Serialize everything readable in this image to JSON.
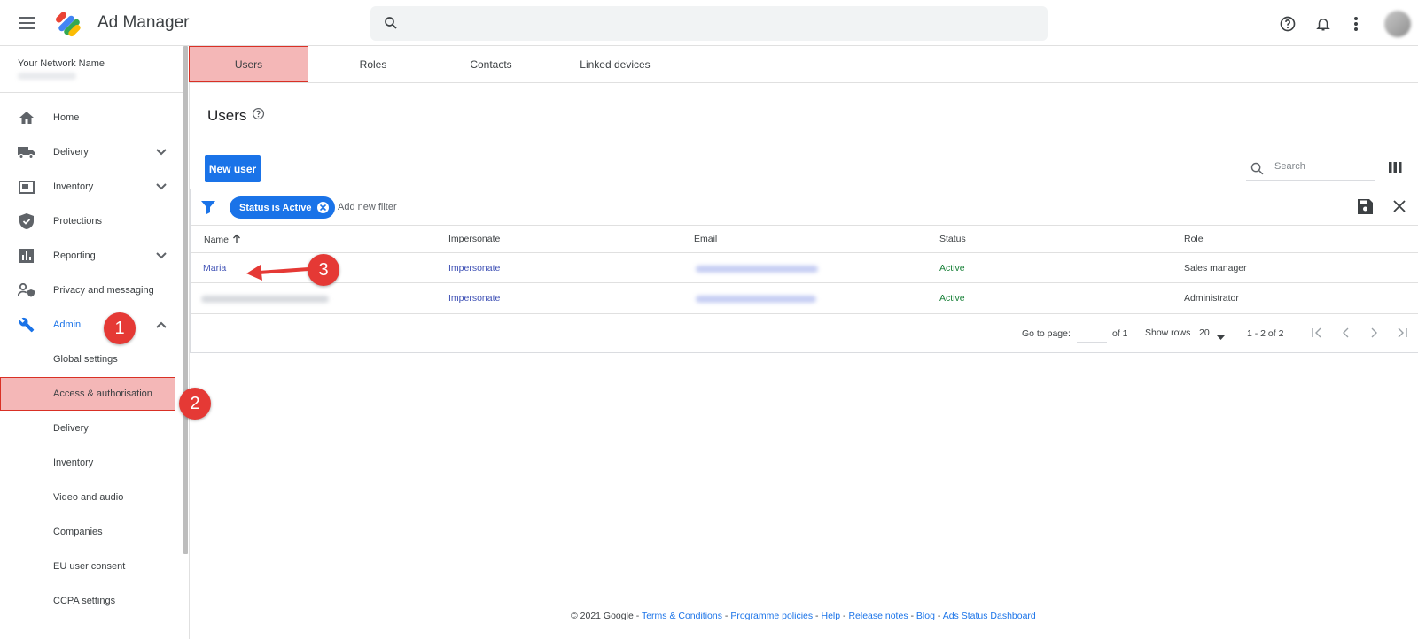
{
  "app": {
    "title": "Ad Manager"
  },
  "network": {
    "name": "Your Network Name"
  },
  "sidebar": {
    "items": [
      {
        "label": "Home"
      },
      {
        "label": "Delivery"
      },
      {
        "label": "Inventory"
      },
      {
        "label": "Protections"
      },
      {
        "label": "Reporting"
      },
      {
        "label": "Privacy and messaging"
      },
      {
        "label": "Admin"
      }
    ],
    "admin_subitems": [
      {
        "label": "Global settings"
      },
      {
        "label": "Access & authorisation"
      },
      {
        "label": "Delivery"
      },
      {
        "label": "Inventory"
      },
      {
        "label": "Video and audio"
      },
      {
        "label": "Companies"
      },
      {
        "label": "EU user consent"
      },
      {
        "label": "CCPA settings"
      }
    ]
  },
  "tabs": [
    "Users",
    "Roles",
    "Contacts",
    "Linked devices"
  ],
  "page": {
    "title": "Users"
  },
  "toolbar": {
    "new_user": "New user",
    "search_placeholder": "Search"
  },
  "filter": {
    "chip": "Status is Active",
    "add_filter": "Add new filter"
  },
  "table": {
    "headers": [
      "Name",
      "Impersonate",
      "Email",
      "Status",
      "Role"
    ],
    "rows": [
      {
        "name": "Maria",
        "impersonate": "Impersonate",
        "status": "Active",
        "role": "Sales manager"
      },
      {
        "name": "",
        "impersonate": "Impersonate",
        "status": "Active",
        "role": "Administrator"
      }
    ]
  },
  "pagination": {
    "go_to_page": "Go to page:",
    "of": "of 1",
    "show_rows": "Show rows",
    "rows_value": "20",
    "range": "1 - 2 of 2"
  },
  "annotations": [
    "1",
    "2",
    "3"
  ],
  "footer": {
    "copyright": "© 2021 Google",
    "links": [
      "Terms & Conditions",
      "Programme policies",
      "Help",
      "Release notes",
      "Blog",
      "Ads Status Dashboard"
    ]
  },
  "colors": {
    "accent": "#1a73e8",
    "highlight": "#f4b7b7",
    "annotation": "#e53935",
    "status": "#188038"
  }
}
